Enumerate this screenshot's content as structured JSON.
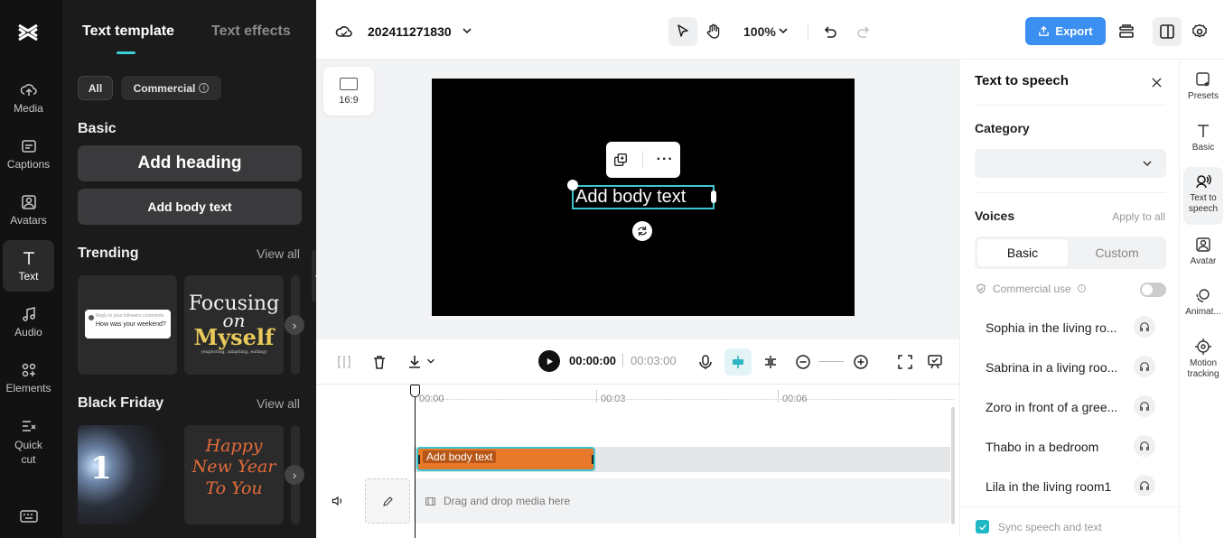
{
  "left_rail": {
    "items": [
      {
        "label": "Media",
        "icon": "cloud-upload-icon"
      },
      {
        "label": "Captions",
        "icon": "captions-icon"
      },
      {
        "label": "Avatars",
        "icon": "avatar-icon"
      },
      {
        "label": "Text",
        "icon": "text-icon"
      },
      {
        "label": "Audio",
        "icon": "music-note-icon"
      },
      {
        "label": "Elements",
        "icon": "elements-icon"
      },
      {
        "label": "Quick cut",
        "icon": "quick-cut-icon"
      }
    ],
    "active": "Text"
  },
  "text_panel": {
    "tabs": [
      "Text template",
      "Text effects"
    ],
    "active_tab": "Text template",
    "filters": [
      "All",
      "Commercial"
    ],
    "basic": {
      "title": "Basic",
      "heading_btn": "Add heading",
      "body_btn": "Add body text"
    },
    "trending": {
      "title": "Trending",
      "view_all": "View all",
      "card1_small": "Reply to your followers comments",
      "card1_text": "How was your weekend?",
      "card2_line1": "Focusing",
      "card2_line2": "on",
      "card2_line3": "Myself",
      "card2_sub": "(exploring, adapting, eating)"
    },
    "black_friday": {
      "title": "Black Friday",
      "view_all": "View all",
      "card1_text": "1",
      "card2_line1": "Happy",
      "card2_line2": "New Year",
      "card2_line3": "To You"
    }
  },
  "topbar": {
    "project_name": "202411271830",
    "zoom": "100%",
    "export_label": "Export",
    "accent": "#3b8ff0"
  },
  "stage": {
    "ratio_label": "16:9",
    "text_element": "Add body text"
  },
  "player": {
    "current_time": "00:00:00",
    "total_time": "00:03:00"
  },
  "timeline": {
    "ticks": [
      "00:00",
      "00:03",
      "00:06"
    ],
    "clip_label": "Add body text",
    "clip_color": "#e8782a",
    "drop_label": "Drag and drop media here"
  },
  "tts_panel": {
    "title": "Text to speech",
    "category_label": "Category",
    "category_value": "",
    "voices_label": "Voices",
    "apply_all": "Apply to all",
    "voice_tabs": [
      "Basic",
      "Custom"
    ],
    "commercial_use": "Commercial use",
    "voices": [
      "Sophia in the living ro...",
      "Sabrina in a living roo...",
      "Zoro in front of a gree...",
      "Thabo in a bedroom",
      "Lila in the living room1"
    ],
    "sync_label": "Sync speech and text"
  },
  "right_rail": {
    "items": [
      {
        "label": "Presets",
        "icon": "presets-icon"
      },
      {
        "label": "Basic",
        "icon": "text-icon"
      },
      {
        "label": "Text to speech",
        "icon": "speech-icon"
      },
      {
        "label": "Avatar",
        "icon": "avatar-icon"
      },
      {
        "label": "Animat...",
        "icon": "animation-icon"
      },
      {
        "label": "Motion tracking",
        "icon": "motion-tracking-icon"
      }
    ],
    "active": "Text to speech"
  }
}
